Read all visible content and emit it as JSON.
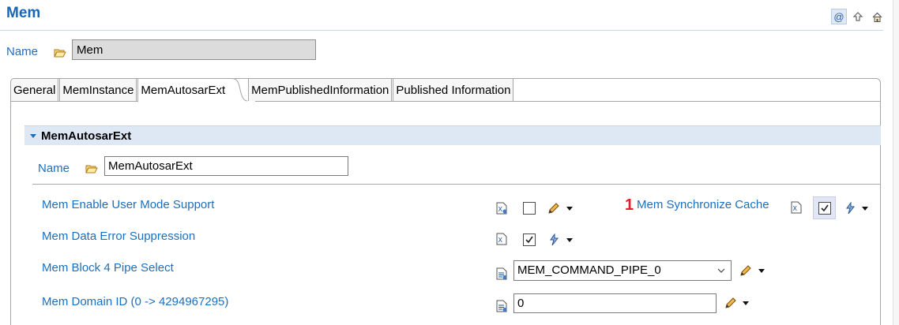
{
  "header": {
    "title": "Mem"
  },
  "top_icons": [
    "at-sign-icon",
    "arrow-up-icon",
    "home-icon"
  ],
  "name_row": {
    "label": "Name",
    "value": "Mem"
  },
  "tabs": [
    {
      "label": "General",
      "active": false
    },
    {
      "label": "MemInstance",
      "active": false
    },
    {
      "label": "MemAutosarExt",
      "active": true
    },
    {
      "label": "MemPublishedInformation",
      "active": false
    },
    {
      "label": "Published Information",
      "active": false
    }
  ],
  "section": {
    "title": "MemAutosarExt",
    "name_label": "Name",
    "name_value": "MemAutosarExt"
  },
  "params": {
    "user_mode": {
      "label": "Mem Enable User Mode Support",
      "checked": false
    },
    "sync_cache": {
      "marker": "1",
      "label": "Mem Synchronize Cache",
      "checked": true
    },
    "data_error": {
      "label": "Mem Data Error Suppression",
      "checked": true
    },
    "pipe_select": {
      "label": "Mem Block 4 Pipe Select",
      "value": "MEM_COMMAND_PIPE_0"
    },
    "domain_id": {
      "label": "Mem Domain ID (0 -> 4294967295)",
      "value": "0"
    }
  },
  "colors": {
    "link": "#1a6fc0",
    "title": "#1767b6",
    "section_bg": "#dde8f4",
    "marker": "#e0202a"
  }
}
